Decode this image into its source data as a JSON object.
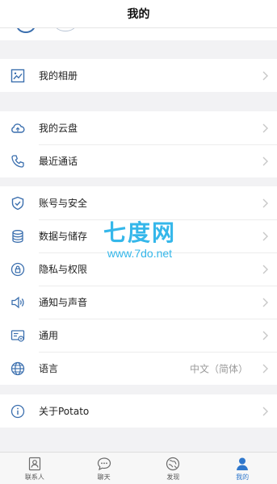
{
  "header": {
    "title": "我的"
  },
  "menu": {
    "album": {
      "label": "我的相册"
    },
    "cloud": {
      "label": "我的云盘"
    },
    "recent_calls": {
      "label": "最近通话"
    },
    "account": {
      "label": "账号与安全"
    },
    "data_storage": {
      "label": "数据与储存"
    },
    "privacy": {
      "label": "隐私与权限"
    },
    "notifications": {
      "label": "通知与声音"
    },
    "general": {
      "label": "通用"
    },
    "language": {
      "label": "语言",
      "value": "中文（简体）"
    },
    "about": {
      "label": "关于Potato"
    }
  },
  "watermark": {
    "title": "七度网",
    "url": "www.7do.net"
  },
  "tabbar": {
    "tabs": [
      {
        "label": "联系人",
        "icon": "contacts-icon"
      },
      {
        "label": "聊天",
        "icon": "chat-icon"
      },
      {
        "label": "发现",
        "icon": "discover-icon"
      },
      {
        "label": "我的",
        "icon": "me-icon",
        "active": true
      }
    ]
  },
  "colors": {
    "accent": "#2f77cc",
    "icon": "#3b6fae",
    "chevron": "#c7c7c7",
    "watermark": "#35b7ea"
  }
}
